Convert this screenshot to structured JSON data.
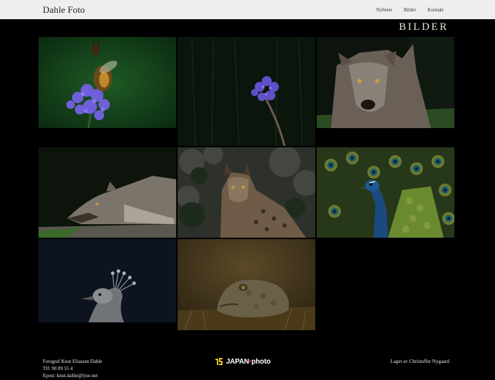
{
  "header": {
    "brand": "Dahle Foto",
    "nav": [
      "Nyheter",
      "Bilder",
      "Kontakt"
    ]
  },
  "section_title": "BILDER",
  "gallery": [
    {
      "subject": "bee on purple flower"
    },
    {
      "subject": "purple flower"
    },
    {
      "subject": "wolf portrait"
    },
    {
      "subject": "wolf lying down"
    },
    {
      "subject": "lynx"
    },
    {
      "subject": "peacock display"
    },
    {
      "subject": "white peacock head"
    },
    {
      "subject": "toad"
    }
  ],
  "footer": {
    "line1": "Fotograf Knut Eliassen Dahle",
    "line2": "Tlf: 90 89 55 4",
    "line3": "Epost: knut.dahle@lyse.net",
    "logo_text_left": "JAPAN",
    "logo_text_right": "photo",
    "credit": "Laget av Christoffer Nygaard"
  },
  "colors": {
    "header_bg": "#eeeeee",
    "page_bg": "#000000",
    "title": "#e6e2d8",
    "footer_text": "#e6e6e6",
    "logo_accent": "#e8c020"
  }
}
